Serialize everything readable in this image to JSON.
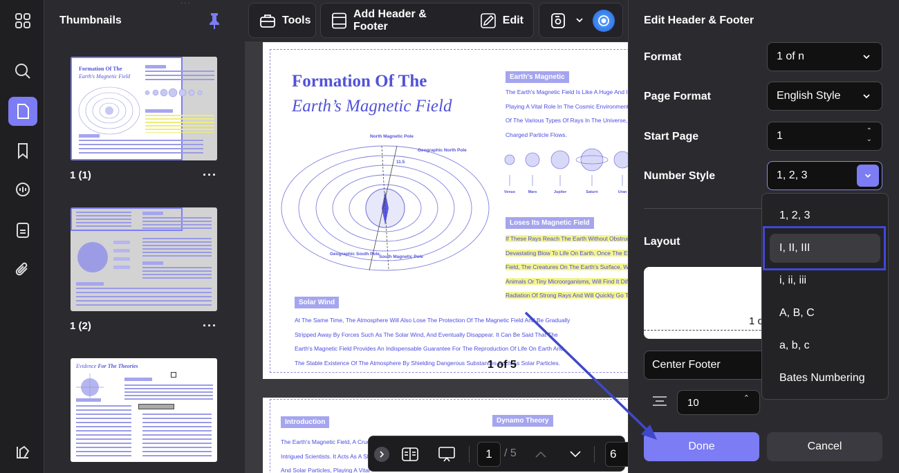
{
  "rail": {
    "icons": [
      "grid-icon",
      "search-icon",
      "pages-icon",
      "bookmark-icon",
      "comment-icon",
      "document-icon",
      "attachment-icon",
      "layers-icon"
    ]
  },
  "thumbnails": {
    "title": "Thumbnails",
    "items": [
      {
        "label": "1 (1)",
        "more": "···"
      },
      {
        "label": "1 (2)",
        "more": "···"
      },
      {
        "label": "",
        "more": ""
      }
    ],
    "thumb1_title_a": "Formation Of The",
    "thumb1_title_b": "Earth's Magnetic Field",
    "thumb3_title_a": "Evidence",
    "thumb3_title_b": "For The Theories"
  },
  "toolbar": {
    "tools_label": "Tools",
    "add_header_footer_label": "Add Header & Footer",
    "edit_label": "Edit"
  },
  "document": {
    "page1": {
      "title_line1": "Formation Of The",
      "title_line2": "Earth’s Magnetic Field",
      "tag_magnetic": "Earth's Magnetic",
      "para1": [
        "The Earth's Magnetic Field Is Like A Huge And Invi",
        "Playing A Vital Role In The Cosmic Environment. It",
        "Of The Various Types Of Rays In The Universe, Su",
        "Charged Particle Flows."
      ],
      "diagram_labels": {
        "north_magnetic": "North Magnetic Pole",
        "geo_north": "Geographic North Pole",
        "geo_south": "Geographic South Pole",
        "south_magnetic": "South Magnetic Pole",
        "angle": "11.5"
      },
      "planets": [
        "Venus",
        "Mars",
        "Jupiter",
        "Saturn",
        "Uran"
      ],
      "tag_loses": "Loses Its Magnetic Field",
      "para2": [
        "If These Rays Reach The Earth Without Obstructio",
        "Devastating Blow To Life On Earth. Once The Earth",
        "Field, The Creatures On The Earth's Surface, Whet",
        "Animals Or Tiny Microorganisms, Will Find It Difficu",
        "Radiation Of Strong Rays And Will Quickly Go To B"
      ],
      "tag_solar": "Solar Wind",
      "para3": [
        "At The Same Time, The Atmosphere Will Also Lose The Protection Of The Magnetic Field And Be Gradually",
        "Stripped Away By Forces Such As The Solar Wind, And Eventually Disappear. It Can Be Said That The",
        "Earth's Magnetic Field Provides An Indispensable Guarantee For The Reproduction Of Life On Earth And",
        "The Stable Existence Of The Atmosphere By Shielding Dangerous Substances Such As Solar Particles."
      ],
      "footer_number": "1 of 5"
    },
    "page2": {
      "tag_intro": "Introduction",
      "tag_dynamo": "Dynamo Theory",
      "para": [
        "The Earth's Magnetic Field, A Cruci",
        "Intrigued Scientists. It Acts As A Sh",
        "And Solar Particles, Playing A Vital"
      ]
    }
  },
  "nav": {
    "current_page": "1",
    "total": "/ 5",
    "zoom": "6"
  },
  "panel": {
    "title": "Edit Header & Footer",
    "format_label": "Format",
    "format_value": "1 of n",
    "page_format_label": "Page Format",
    "page_format_value": "English Style",
    "start_page_label": "Start Page",
    "start_page_value": "1",
    "number_style_label": "Number Style",
    "number_style_value": "1, 2, 3",
    "layout_label": "Layout",
    "layout_preview_text": "1 o",
    "position_value": "Center Footer",
    "size_value": "10",
    "size_value2": "10",
    "done_label": "Done",
    "cancel_label": "Cancel"
  },
  "dropdown": {
    "options": [
      "1, 2, 3",
      "I, II, III",
      "i, ii, iii",
      "A, B, C",
      "a, b, c",
      "Bates Numbering"
    ],
    "selected": "I, II, III"
  },
  "colors": {
    "accent": "#7c7cf5",
    "doc_blue": "#4b4be0",
    "focus_outline": "#3f48d8",
    "annotation_arrow": "#3f48c8"
  }
}
